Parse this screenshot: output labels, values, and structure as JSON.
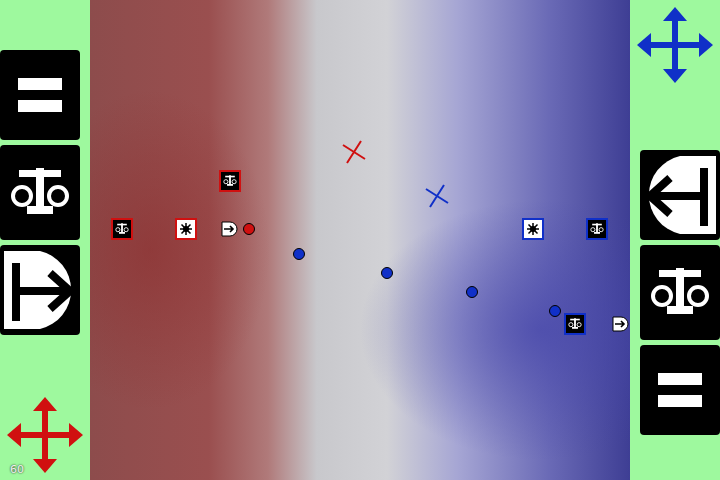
{
  "hud": {
    "fps": "60"
  },
  "players": [
    {
      "kind": "left",
      "color": "#d01010"
    },
    {
      "kind": "right",
      "color": "#1030c8"
    }
  ],
  "units": [
    {
      "kind": "turret",
      "player": 0
    },
    {
      "kind": "turret",
      "player": 0
    },
    {
      "kind": "gear",
      "player": 0
    },
    {
      "kind": "base",
      "player": 0
    },
    {
      "kind": "gear",
      "player": 1
    },
    {
      "kind": "turret",
      "player": 1
    },
    {
      "kind": "turret",
      "player": 1
    },
    {
      "kind": "base",
      "player": 1
    }
  ],
  "balls": [
    {
      "player": 0
    },
    {
      "player": 1
    },
    {
      "player": 1
    },
    {
      "player": 1
    },
    {
      "player": 1
    }
  ],
  "cursors": [
    {
      "player": 0
    },
    {
      "player": 1
    }
  ]
}
